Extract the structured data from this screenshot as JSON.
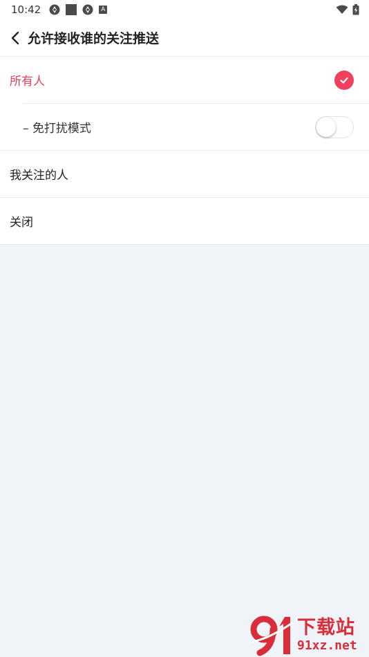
{
  "status_bar": {
    "time": "10:42",
    "left_icons": [
      "aperture-icon",
      "square-icon",
      "aperture-icon",
      "a-badge-icon"
    ],
    "a_badge": "A",
    "right_icons": [
      "wifi-icon",
      "battery-charging-icon"
    ]
  },
  "header": {
    "title": "允许接收谁的关注推送"
  },
  "options": [
    {
      "label": "所有人",
      "selected": true
    },
    {
      "label": "– 免打扰模式",
      "toggle": false
    },
    {
      "label": "我关注的人",
      "selected": false
    },
    {
      "label": "关闭",
      "selected": false
    }
  ],
  "watermark": {
    "big": "下载站",
    "small": "91xz.net"
  },
  "colors": {
    "accent": "#f0405c",
    "active_text": "#e8405a",
    "background": "#f0f3f7",
    "watermark": "#d92d3a"
  }
}
